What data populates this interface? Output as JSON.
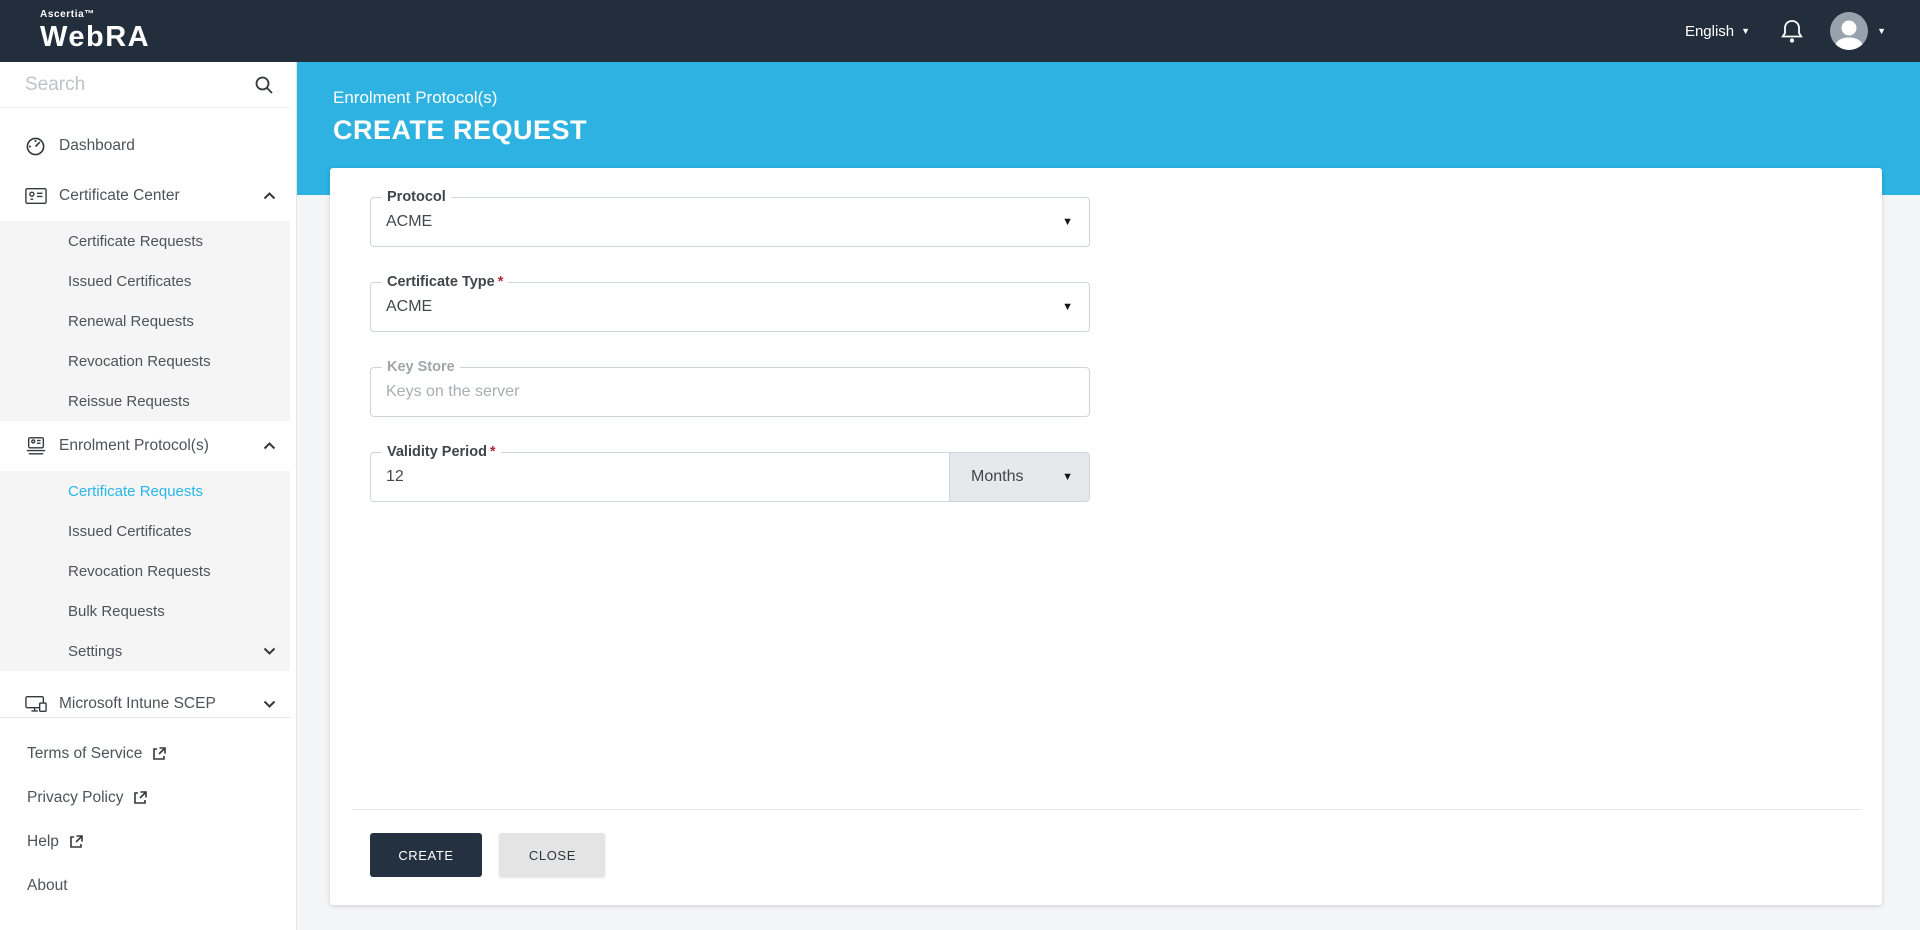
{
  "navbar": {
    "brand_top": "Ascertia™",
    "brand": "WebRA",
    "language": "English"
  },
  "header": {
    "breadcrumb": "Enrolment Protocol(s)",
    "title": "CREATE REQUEST"
  },
  "sidebar": {
    "search_placeholder": "Search",
    "dashboard": "Dashboard",
    "certificate_center": {
      "label": "Certificate Center",
      "children": [
        "Certificate Requests",
        "Issued Certificates",
        "Renewal Requests",
        "Revocation Requests",
        "Reissue Requests"
      ]
    },
    "enrolment_protocols": {
      "label": "Enrolment Protocol(s)",
      "active_child": "Certificate Requests",
      "children": [
        "Certificate Requests",
        "Issued Certificates",
        "Revocation Requests",
        "Bulk Requests",
        "Settings"
      ]
    },
    "intune": "Microsoft Intune SCEP",
    "footer": [
      "Terms of Service",
      "Privacy Policy",
      "Help",
      "About"
    ]
  },
  "form": {
    "protocol": {
      "label": "Protocol",
      "value": "ACME"
    },
    "certificate_type": {
      "label": "Certificate Type",
      "value": "ACME",
      "required_marker": "*"
    },
    "key_store": {
      "label": "Key Store",
      "placeholder": "Keys on the server"
    },
    "validity_period": {
      "label": "Validity Period",
      "value": "12",
      "unit": "Months",
      "required_marker": "*"
    },
    "actions": {
      "create": "CREATE",
      "close": "CLOSE"
    }
  },
  "colors": {
    "accent": "#2db2e2",
    "navbar_bg": "#232e3c",
    "active_link": "#29b6e8",
    "required": "#b02a37",
    "primary_button": "#243140"
  }
}
